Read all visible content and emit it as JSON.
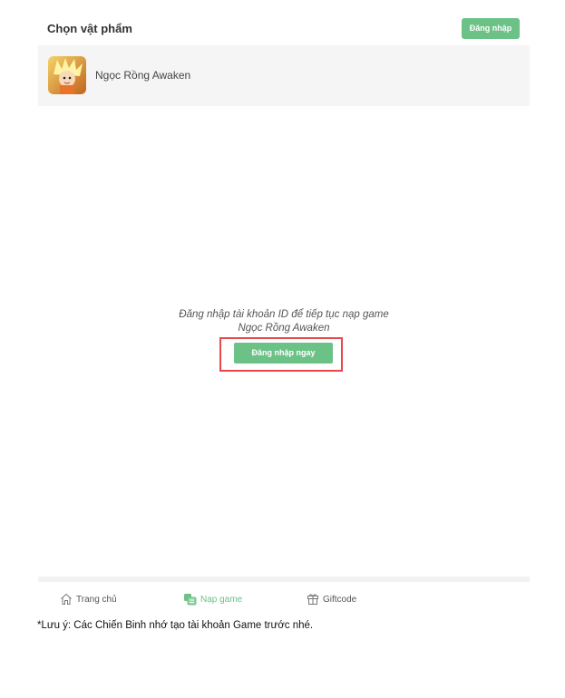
{
  "header": {
    "title": "Chọn vật phẩm",
    "login_label": "Đăng nhập"
  },
  "game": {
    "name": "Ngọc Rồng Awaken",
    "icon": "game-avatar-icon"
  },
  "empty_state": {
    "message_line1": "Đăng nhập tài khoản ID để tiếp tục nạp game",
    "message_line2": "Ngọc Rồng Awaken",
    "button_label": "Đăng nhập ngay"
  },
  "nav": {
    "items": [
      {
        "label": "Trang chủ",
        "icon": "home-icon",
        "active": false
      },
      {
        "label": "Nạp game",
        "icon": "coins-icon",
        "active": true
      },
      {
        "label": "Giftcode",
        "icon": "gift-icon",
        "active": false
      }
    ]
  },
  "note": "*Lưu ý: Các Chiến Binh nhớ tạo tài khoản Game trước nhé.",
  "colors": {
    "accent": "#6cc186",
    "highlight_border": "#e8474c"
  }
}
